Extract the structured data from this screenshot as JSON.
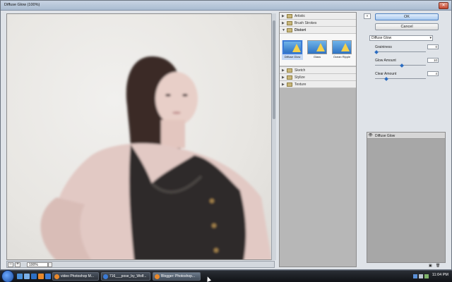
{
  "window": {
    "title": "Diffuse Glow (100%)",
    "close_glyph": "✕"
  },
  "preview": {
    "zoom_minus": "−",
    "zoom_plus": "+",
    "zoom_value": "100%"
  },
  "gallery": {
    "categories": [
      {
        "label": "Artistic"
      },
      {
        "label": "Brush Strokes"
      },
      {
        "label": "Distort"
      },
      {
        "label": "Sketch"
      },
      {
        "label": "Stylize"
      },
      {
        "label": "Texture"
      }
    ],
    "collapsed_arrow": "▶",
    "expanded_arrow": "▼",
    "distort_filters": [
      {
        "label": "Diffuse Glow",
        "selected": true
      },
      {
        "label": "Glass",
        "selected": false
      },
      {
        "label": "Ocean Ripple",
        "selected": false
      }
    ]
  },
  "right_panel": {
    "collapse_glyph": "«",
    "ok_label": "OK",
    "cancel_label": "Cancel",
    "filter_select": "Diffuse Glow",
    "dropdown_glyph": "▾",
    "params": [
      {
        "label": "Graininess",
        "value": "0",
        "fraction": 0
      },
      {
        "label": "Glow Amount",
        "value": "10",
        "fraction": 0.5
      },
      {
        "label": "Clear Amount",
        "value": "4",
        "fraction": 0.2
      }
    ],
    "layers": [
      {
        "name": "Diffuse Glow",
        "visible_glyph": "👁"
      }
    ],
    "layer_new_glyph": "▣",
    "layer_delete_glyph": "🗑"
  },
  "taskbar": {
    "tasks": [
      {
        "label": "video Photoshop M...",
        "icon_color": "#e8882b"
      },
      {
        "label": "716___pose_by_Wolf...",
        "icon_color": "#3b7bd6"
      },
      {
        "label": "Blogger: Photoshop...",
        "icon_color": "#e8882b"
      }
    ],
    "clock": "11:04 PM"
  },
  "colors": {
    "accent": "#3c7bd6",
    "taskbar": "#1a1d22"
  }
}
